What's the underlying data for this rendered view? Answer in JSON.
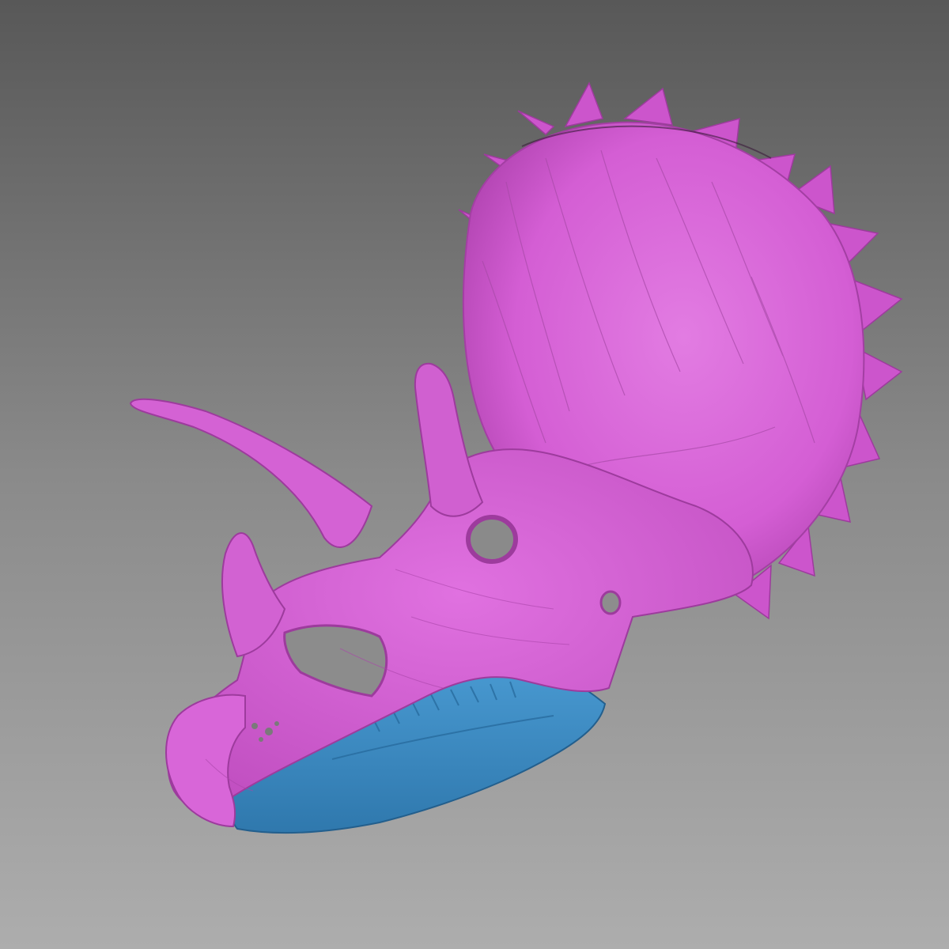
{
  "viewport": {
    "background_top": "#585858",
    "background_bottom": "#adadad"
  },
  "model": {
    "skull_color": "#d45ed4",
    "skull_shadow": "#a33fa3",
    "skull_highlight": "#ee8cee",
    "jaw_color": "#3b8cc6",
    "jaw_shadow": "#276a9c"
  }
}
